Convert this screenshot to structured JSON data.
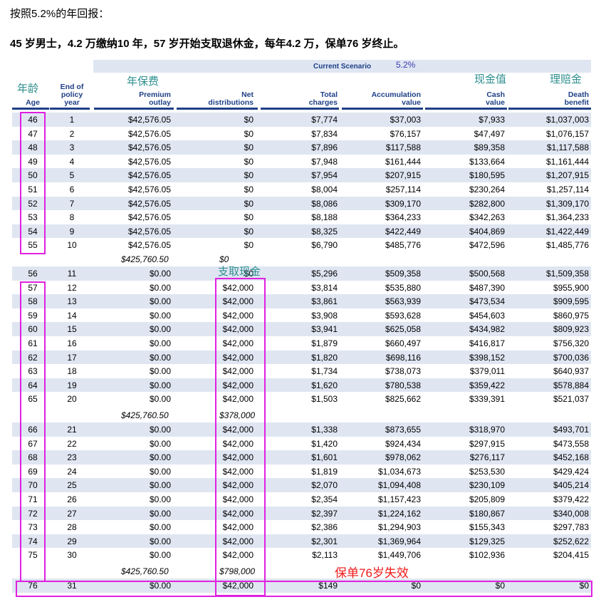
{
  "headings": {
    "line1": "按照5.2%的年回报：",
    "line2": "45 岁男士，4.2 万缴纳10 年，57 岁开始支取退休金，每年4.2 万，保单76 岁终止。"
  },
  "scenario": {
    "label": "Current Scenario",
    "rate": "5.2%"
  },
  "chinese_labels": {
    "age": "年龄",
    "premium": "年保费",
    "cash": "现金值",
    "death": "理赔金",
    "withdraw": "支取现金"
  },
  "columns": [
    {
      "key": "age",
      "label": "Age"
    },
    {
      "key": "year",
      "label": "End of policy year"
    },
    {
      "key": "premium",
      "label": "Premium outlay"
    },
    {
      "key": "dist",
      "label": "Net distributions"
    },
    {
      "key": "charges",
      "label": "Total charges"
    },
    {
      "key": "accum",
      "label": "Accumulation value"
    },
    {
      "key": "cash",
      "label": "Cash value"
    },
    {
      "key": "death",
      "label": "Death benefit"
    }
  ],
  "header_lines": {
    "age": [
      "Age"
    ],
    "year": [
      "End of",
      "policy",
      "year"
    ],
    "premium": [
      "Premium",
      "outlay"
    ],
    "dist": [
      "Net",
      "distributions"
    ],
    "charges": [
      "Total",
      "charges"
    ],
    "accum": [
      "Accumulation",
      "value"
    ],
    "cash": [
      "Cash",
      "value"
    ],
    "death": [
      "Death",
      "benefit"
    ]
  },
  "rows": [
    [
      "46",
      "1",
      "$42,576.05",
      "$0",
      "$7,774",
      "$37,003",
      "$7,933",
      "$1,037,003"
    ],
    [
      "47",
      "2",
      "$42,576.05",
      "$0",
      "$7,834",
      "$76,157",
      "$47,497",
      "$1,076,157"
    ],
    [
      "48",
      "3",
      "$42,576.05",
      "$0",
      "$7,896",
      "$117,588",
      "$89,358",
      "$1,117,588"
    ],
    [
      "49",
      "4",
      "$42,576.05",
      "$0",
      "$7,948",
      "$161,444",
      "$133,664",
      "$1,161,444"
    ],
    [
      "50",
      "5",
      "$42,576.05",
      "$0",
      "$7,954",
      "$207,915",
      "$180,595",
      "$1,207,915"
    ],
    [
      "51",
      "6",
      "$42,576.05",
      "$0",
      "$8,004",
      "$257,114",
      "$230,264",
      "$1,257,114"
    ],
    [
      "52",
      "7",
      "$42,576.05",
      "$0",
      "$8,086",
      "$309,170",
      "$282,800",
      "$1,309,170"
    ],
    [
      "53",
      "8",
      "$42,576.05",
      "$0",
      "$8,188",
      "$364,233",
      "$342,263",
      "$1,364,233"
    ],
    [
      "54",
      "9",
      "$42,576.05",
      "$0",
      "$8,325",
      "$422,449",
      "$404,869",
      "$1,422,449"
    ],
    [
      "55",
      "10",
      "$42,576.05",
      "$0",
      "$6,790",
      "$485,776",
      "$472,596",
      "$1,485,776"
    ],
    [
      "56",
      "11",
      "$0.00",
      "$0",
      "$5,296",
      "$509,358",
      "$500,568",
      "$1,509,358"
    ],
    [
      "57",
      "12",
      "$0.00",
      "$42,000",
      "$3,814",
      "$535,880",
      "$487,390",
      "$955,900"
    ],
    [
      "58",
      "13",
      "$0.00",
      "$42,000",
      "$3,861",
      "$563,939",
      "$473,534",
      "$909,595"
    ],
    [
      "59",
      "14",
      "$0.00",
      "$42,000",
      "$3,908",
      "$593,628",
      "$454,603",
      "$860,975"
    ],
    [
      "60",
      "15",
      "$0.00",
      "$42,000",
      "$3,941",
      "$625,058",
      "$434,982",
      "$809,923"
    ],
    [
      "61",
      "16",
      "$0.00",
      "$42,000",
      "$1,879",
      "$660,497",
      "$416,817",
      "$756,320"
    ],
    [
      "62",
      "17",
      "$0.00",
      "$42,000",
      "$1,820",
      "$698,116",
      "$398,152",
      "$700,036"
    ],
    [
      "63",
      "18",
      "$0.00",
      "$42,000",
      "$1,734",
      "$738,073",
      "$379,011",
      "$640,937"
    ],
    [
      "64",
      "19",
      "$0.00",
      "$42,000",
      "$1,620",
      "$780,538",
      "$359,422",
      "$578,884"
    ],
    [
      "65",
      "20",
      "$0.00",
      "$42,000",
      "$1,503",
      "$825,662",
      "$339,391",
      "$521,037"
    ],
    [
      "66",
      "21",
      "$0.00",
      "$42,000",
      "$1,338",
      "$873,655",
      "$318,970",
      "$493,701"
    ],
    [
      "67",
      "22",
      "$0.00",
      "$42,000",
      "$1,420",
      "$924,434",
      "$297,915",
      "$473,558"
    ],
    [
      "68",
      "23",
      "$0.00",
      "$42,000",
      "$1,601",
      "$978,062",
      "$276,117",
      "$452,168"
    ],
    [
      "69",
      "24",
      "$0.00",
      "$42,000",
      "$1,819",
      "$1,034,673",
      "$253,530",
      "$429,424"
    ],
    [
      "70",
      "25",
      "$0.00",
      "$42,000",
      "$2,070",
      "$1,094,408",
      "$230,109",
      "$405,214"
    ],
    [
      "71",
      "26",
      "$0.00",
      "$42,000",
      "$2,354",
      "$1,157,423",
      "$205,809",
      "$379,422"
    ],
    [
      "72",
      "27",
      "$0.00",
      "$42,000",
      "$2,397",
      "$1,224,162",
      "$180,867",
      "$340,008"
    ],
    [
      "73",
      "28",
      "$0.00",
      "$42,000",
      "$2,386",
      "$1,294,903",
      "$155,343",
      "$297,783"
    ],
    [
      "74",
      "29",
      "$0.00",
      "$42,000",
      "$2,301",
      "$1,369,964",
      "$129,325",
      "$252,622"
    ],
    [
      "75",
      "30",
      "$0.00",
      "$42,000",
      "$2,113",
      "$1,449,706",
      "$102,936",
      "$204,415"
    ],
    [
      "76",
      "31",
      "$0.00",
      "$42,000",
      "$149",
      "$0",
      "$0",
      "$0"
    ]
  ],
  "subtotals": [
    {
      "premium": "$425,760.50",
      "dist": "$0"
    },
    {
      "premium": "$425,760.50",
      "dist": "$378,000"
    },
    {
      "premium": "$425,760.50",
      "dist": "$798,000"
    }
  ],
  "note": "保单76岁失效"
}
